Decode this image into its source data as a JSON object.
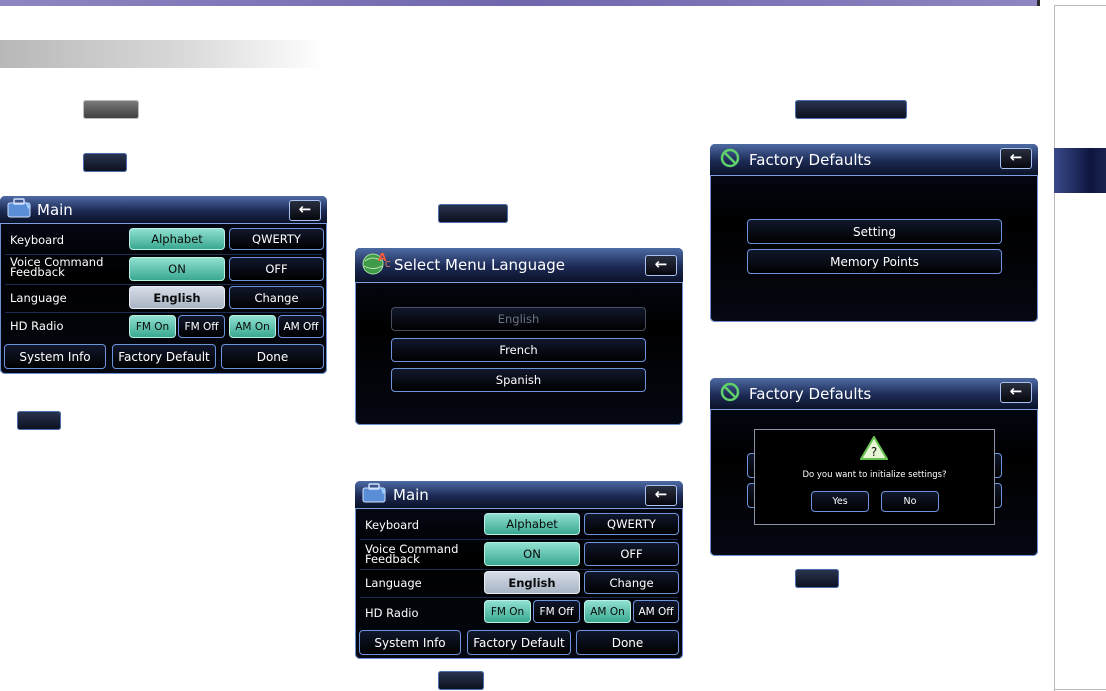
{
  "page": {
    "accent_color": "#6e67ad",
    "chapter_tab_color": "#0e1640",
    "screen_border_color": "#6c8fd2"
  },
  "main_screen": {
    "title": "Main",
    "title_icon": "toolbox-icon",
    "back_icon": "back-arrow-icon",
    "back_label": "←",
    "rows": {
      "keyboard": {
        "label": "Keyboard",
        "options": [
          "Alphabet",
          "QWERTY"
        ],
        "selected": "Alphabet"
      },
      "voice": {
        "label_line1": "Voice Command",
        "label_line2": "Feedback",
        "options": [
          "ON",
          "OFF"
        ],
        "selected": "ON"
      },
      "language": {
        "label": "Language",
        "value": "English",
        "change": "Change"
      },
      "hd_radio": {
        "label": "HD Radio",
        "fm_on": "FM On",
        "fm_off": "FM Off",
        "am_on": "AM On",
        "am_off": "AM Off"
      }
    },
    "bottom": {
      "system_info": "System Info",
      "factory_default": "Factory Default",
      "done": "Done"
    }
  },
  "language_screen": {
    "title": "Select Menu Language",
    "title_icon": "globe-language-icon",
    "back_label": "←",
    "options": [
      "English",
      "French",
      "Spanish"
    ],
    "disabled_option": "English"
  },
  "factory_screen": {
    "title": "Factory Defaults",
    "title_icon": "no-entry-icon",
    "back_label": "←",
    "options": [
      "Setting",
      "Memory Points"
    ]
  },
  "factory_dialog_screen": {
    "title": "Factory Defaults",
    "title_icon": "no-entry-icon",
    "back_label": "←",
    "warning_icon": "warning-triangle-icon",
    "warning_symbol": "?",
    "message": "Do you want to initialize settings?",
    "yes": "Yes",
    "no": "No"
  }
}
